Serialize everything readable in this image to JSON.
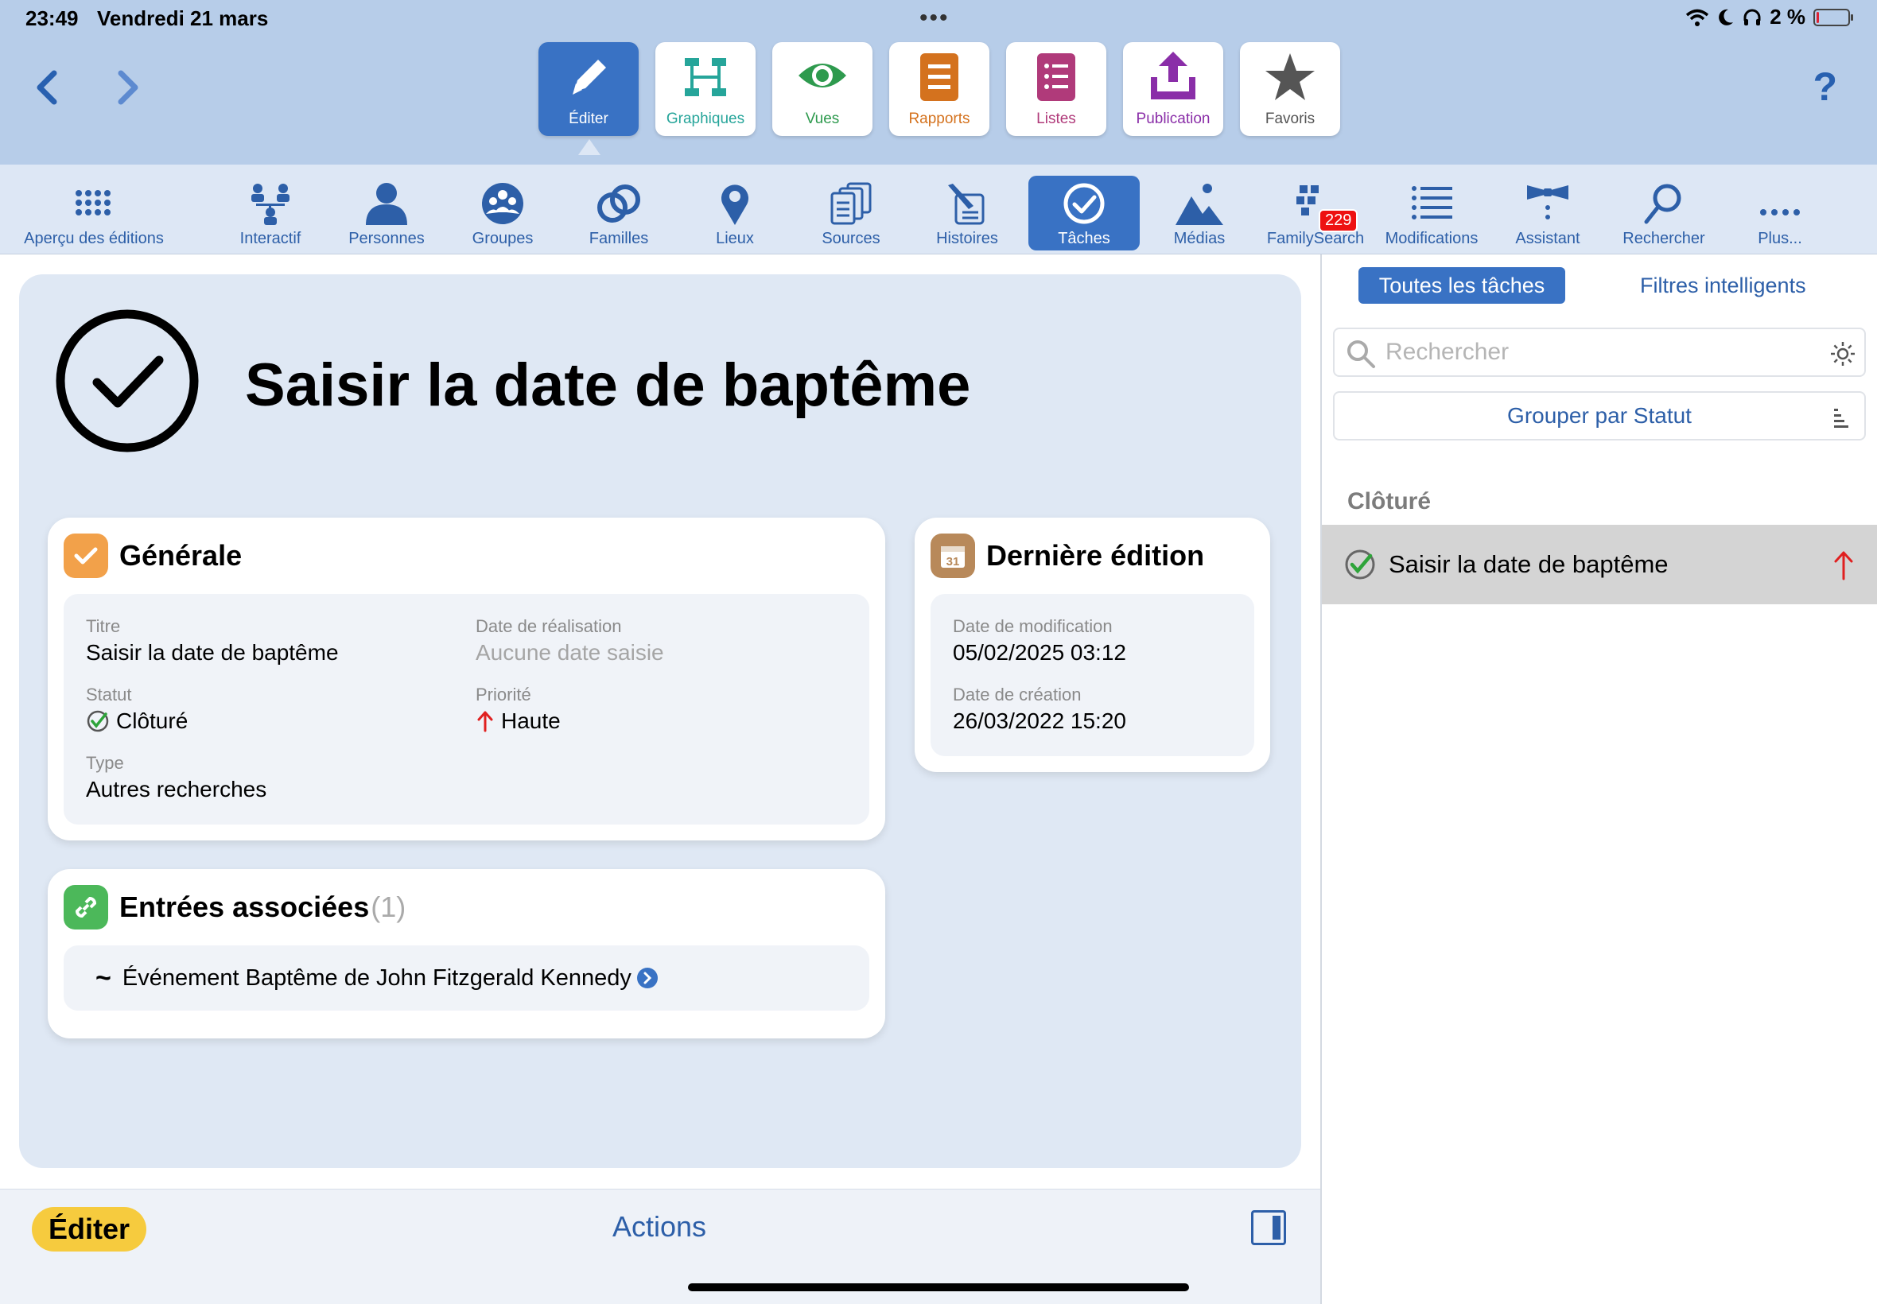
{
  "status": {
    "time": "23:49",
    "date": "Vendredi 21 mars",
    "battery": "2 %",
    "battery_level": 0.02
  },
  "help_label": "?",
  "modes": [
    {
      "label": "Éditer",
      "icon": "pencil-icon",
      "color": "#ffffff"
    },
    {
      "label": "Graphiques",
      "icon": "chart-tree-icon",
      "color": "#26a59a"
    },
    {
      "label": "Vues",
      "icon": "eye-icon",
      "color": "#2e9a4e"
    },
    {
      "label": "Rapports",
      "icon": "report-icon",
      "color": "#d4721e"
    },
    {
      "label": "Listes",
      "icon": "list-icon",
      "color": "#b03a7a"
    },
    {
      "label": "Publication",
      "icon": "upload-icon",
      "color": "#8a2ea8"
    },
    {
      "label": "Favoris",
      "icon": "star-icon",
      "color": "#555555"
    }
  ],
  "toolbar": [
    {
      "label": "Aperçu des éditions",
      "icon": "grid-dots-icon"
    },
    {
      "label": "Interactif",
      "icon": "family-tree-icon"
    },
    {
      "label": "Personnes",
      "icon": "person-icon"
    },
    {
      "label": "Groupes",
      "icon": "group-icon"
    },
    {
      "label": "Familles",
      "icon": "rings-icon"
    },
    {
      "label": "Lieux",
      "icon": "pin-icon"
    },
    {
      "label": "Sources",
      "icon": "documents-icon"
    },
    {
      "label": "Histoires",
      "icon": "story-pen-icon"
    },
    {
      "label": "Tâches",
      "icon": "checkmark-circle-icon"
    },
    {
      "label": "Médias",
      "icon": "mountain-icon"
    },
    {
      "label": "FamilySearch",
      "icon": "familysearch-icon",
      "badge": "229"
    },
    {
      "label": "Modifications",
      "icon": "list-lines-icon"
    },
    {
      "label": "Assistant",
      "icon": "bowtie-icon"
    },
    {
      "label": "Rechercher",
      "icon": "magnifier-icon"
    },
    {
      "label": "Plus...",
      "icon": "more-dots-icon"
    }
  ],
  "detail": {
    "title": "Saisir la date de baptême",
    "general": {
      "heading": "Générale",
      "title_label": "Titre",
      "title_value": "Saisir la date de baptême",
      "done_label": "Date de réalisation",
      "done_value": "Aucune date saisie",
      "status_label": "Statut",
      "status_value": "Clôturé",
      "priority_label": "Priorité",
      "priority_value": "Haute",
      "type_label": "Type",
      "type_value": "Autres recherches"
    },
    "last_edit": {
      "heading": "Dernière édition",
      "calendar_day": "31",
      "modified_label": "Date de modification",
      "modified_value": "05/02/2025 03:12",
      "created_label": "Date de création",
      "created_value": "26/03/2022 15:20"
    },
    "linked": {
      "heading": "Entrées associées",
      "count": "(1)",
      "entry_symbol": "~",
      "entry": "Événement Baptême de John Fitzgerald Kennedy"
    }
  },
  "bottom": {
    "edit_label": "Éditer",
    "actions_label": "Actions"
  },
  "sidebar": {
    "seg_all": "Toutes les tâches",
    "seg_smart": "Filtres intelligents",
    "search_placeholder": "Rechercher",
    "group_label": "Grouper par Statut",
    "section": "Clôturé",
    "task": "Saisir la date de baptême"
  },
  "colors": {
    "accent": "#3972c4",
    "link": "#2d5fa8",
    "edit_button": "#f6cb3e",
    "priority_high": "#e02020",
    "status_done": "#2ea43a"
  }
}
